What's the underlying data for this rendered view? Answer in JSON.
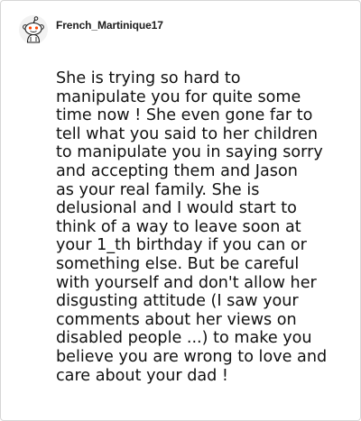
{
  "comment": {
    "author": "French_Martinique17",
    "avatar_icon": "snoo-avatar-icon",
    "body": "She is trying so hard to\nmanipulate you for quite some\ntime now ! She even gone far to\ntell what you said to her children\nto manipulate you in saying sorry\nand accepting them and Jason\nas your real family. She is\ndelusional and I would start to\nthink of a way to leave soon at\nyour 1_th birthday if you can or\nsomething else. But be careful\nwith yourself and don't allow her\ndisgusting attitude (I saw your\ncomments about her views on\ndisabled people ...) to make you\nbelieve you are wrong to love and\ncare about your dad !"
  },
  "colors": {
    "text": "#111111",
    "username": "#1c1c1c",
    "border": "#d6d6d6",
    "background": "#ffffff"
  }
}
